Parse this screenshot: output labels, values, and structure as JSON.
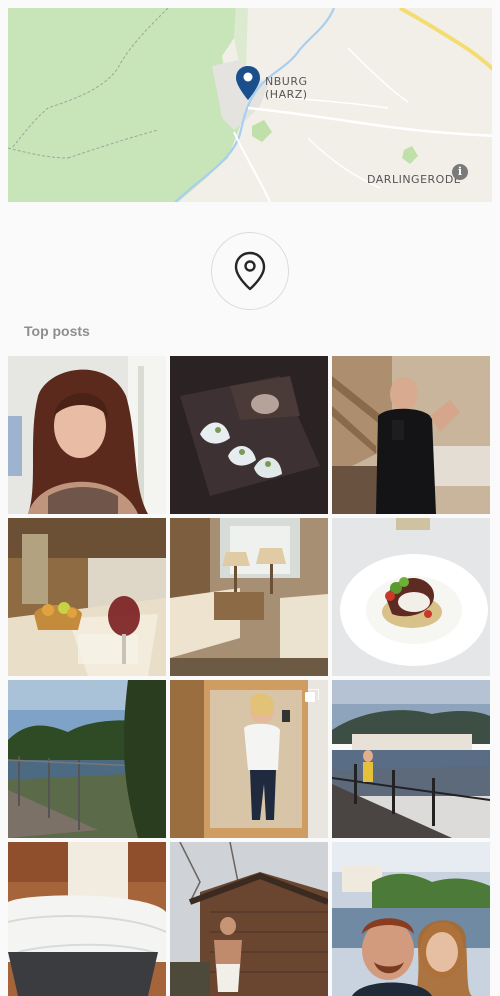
{
  "map": {
    "town_label_1": "NBURG",
    "town_label_2": "(HARZ)",
    "village_label": "DARLINGERODE",
    "info_glyph": "i"
  },
  "location_icon": "location-pin-icon",
  "top_posts": {
    "title": "Top posts",
    "items": [
      {
        "subject": "selfie-woman",
        "multi": false
      },
      {
        "subject": "dessert-plate",
        "multi": false
      },
      {
        "subject": "mirror-selfie-man",
        "multi": false
      },
      {
        "subject": "hotel-room-wine",
        "multi": false
      },
      {
        "subject": "hotel-room",
        "multi": false
      },
      {
        "subject": "gourmet-dish",
        "multi": false
      },
      {
        "subject": "lake-view",
        "multi": false
      },
      {
        "subject": "mirror-selfie-woman",
        "multi": true
      },
      {
        "subject": "lakeside-town",
        "multi": false
      },
      {
        "subject": "sauna-towels",
        "multi": false
      },
      {
        "subject": "sauna-cabin",
        "multi": false
      },
      {
        "subject": "couple-selfie",
        "multi": false
      }
    ]
  }
}
